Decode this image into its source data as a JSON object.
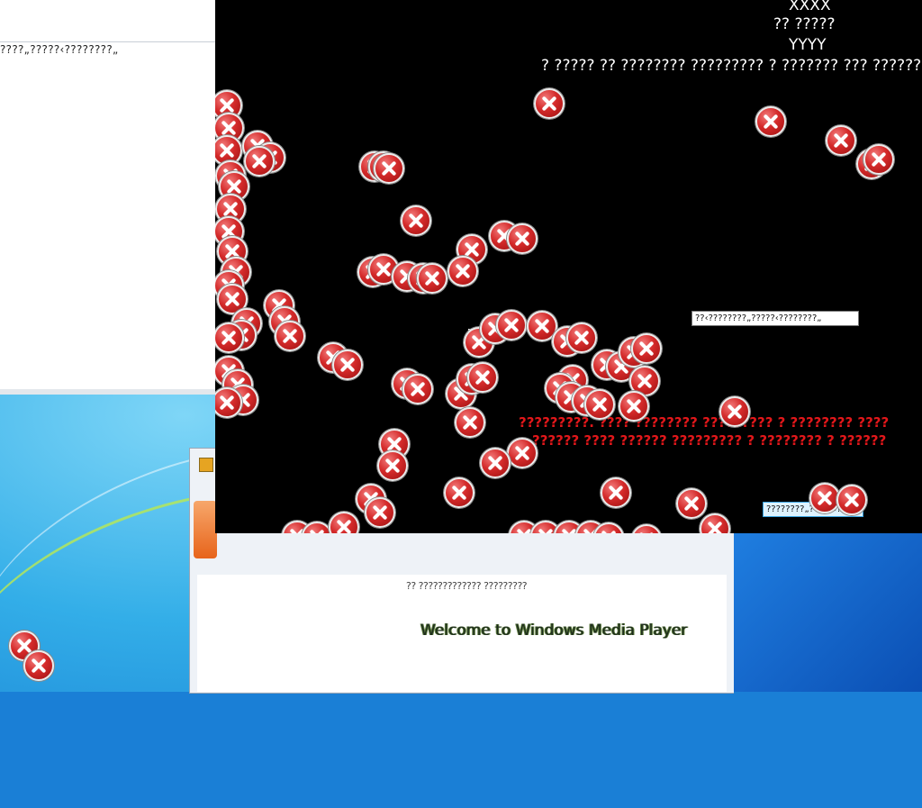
{
  "left_window": {
    "text": "????„?????‹????????„"
  },
  "black_window": {
    "line1": "XXXX",
    "line2": "?? ?????",
    "line3": "YYYY",
    "line4": "? ????? ?? ???????? ????????? ? ??????? ??? ??????",
    "red_line1": "?????????. ???? ???????? ????????? ? ???????? ????",
    "red_line2": "?????? ???? ?????? ????????? ? ???????? ? ??????",
    "chip1": "??‹????????„?????‹????????„",
    "chip2": "????????„?????‹??????"
  },
  "wmp_window": {
    "garbled": "?? ????????????? ?????????",
    "welcome": "Welcome to Windows Media Player"
  },
  "colors": {
    "error_red": "#d42a2a",
    "red_text": "#e1171a"
  },
  "icons": [
    "error-x-icon",
    "media-player-icon"
  ]
}
